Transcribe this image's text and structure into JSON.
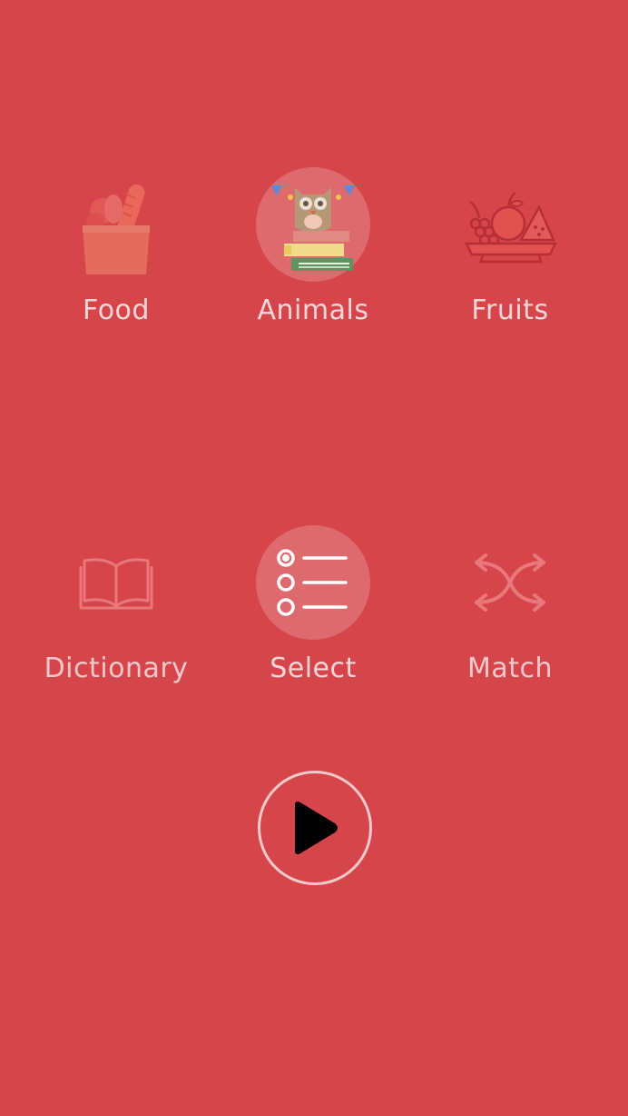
{
  "categories": [
    {
      "label": "Food",
      "icon": "grocery-bag-icon",
      "selected": false
    },
    {
      "label": "Animals",
      "icon": "owl-on-books-icon",
      "selected": true
    },
    {
      "label": "Fruits",
      "icon": "fruit-bowl-icon",
      "selected": false
    }
  ],
  "modes": [
    {
      "label": "Dictionary",
      "icon": "open-book-icon",
      "selected": false
    },
    {
      "label": "Select",
      "icon": "radio-list-icon",
      "selected": true
    },
    {
      "label": "Match",
      "icon": "shuffle-icon",
      "selected": false
    }
  ],
  "play": {
    "icon": "play-icon"
  },
  "colors": {
    "background": "#d6454a",
    "selected_highlight": "rgba(255,255,255,0.2)",
    "label": "#f5d6d6",
    "play_ring": "#f4c9ca"
  }
}
